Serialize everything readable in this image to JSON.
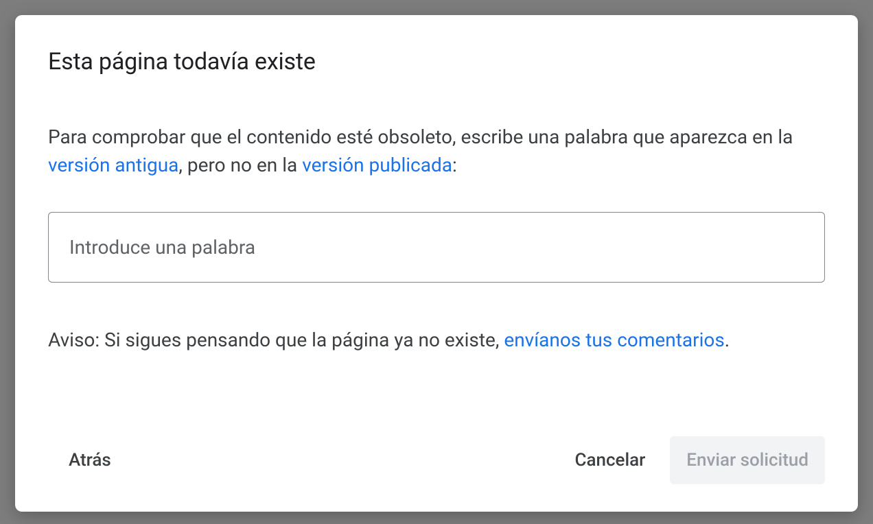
{
  "dialog": {
    "title": "Esta página todavía existe",
    "description": {
      "part1": "Para comprobar que el contenido esté obsoleto, escribe una palabra que aparezca en la ",
      "link_old": "versión antigua",
      "part2": ", pero no en la ",
      "link_live": "versión publicada",
      "part3": ":"
    },
    "input": {
      "placeholder": "Introduce una palabra",
      "value": ""
    },
    "notice": {
      "part1": "Aviso: Si sigues pensando que la página ya no existe, ",
      "link_feedback": "envíanos tus comentarios",
      "part2": "."
    },
    "footer": {
      "back": "Atrás",
      "cancel": "Cancelar",
      "submit": "Enviar solicitud"
    }
  }
}
